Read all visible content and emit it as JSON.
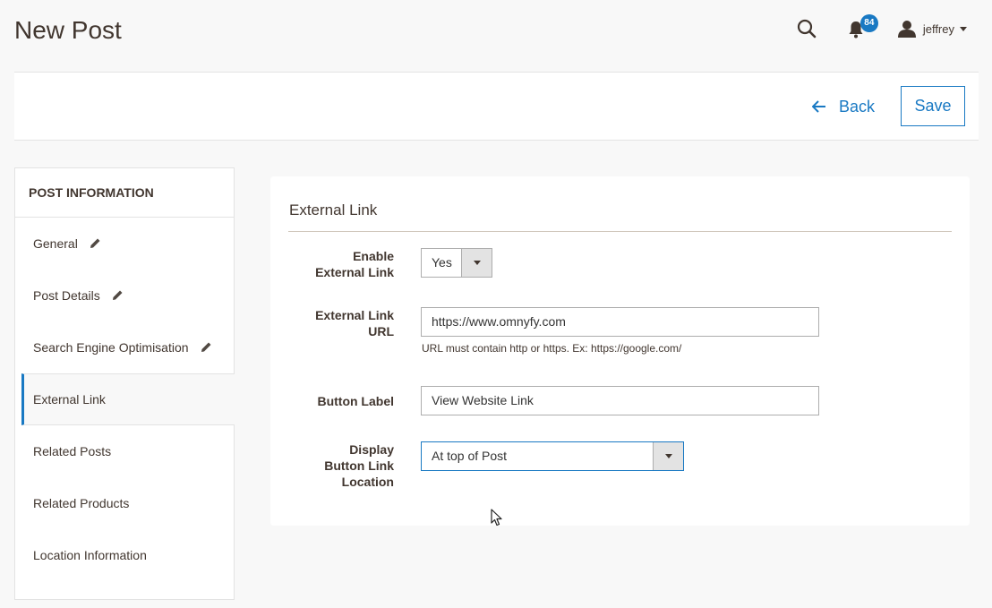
{
  "header": {
    "title": "New Post",
    "notifications_count": "84",
    "user_name": "jeffrey",
    "icons": {
      "search": "search-icon",
      "notifications": "bell-icon",
      "user": "user-icon",
      "dropdown": "caret-down-icon"
    }
  },
  "toolbar": {
    "back_label": "Back",
    "save_label": "Save"
  },
  "sidebar": {
    "title": "POST INFORMATION",
    "items": [
      {
        "label": "General",
        "edited": true
      },
      {
        "label": "Post Details",
        "edited": true
      },
      {
        "label": "Search Engine Optimisation",
        "edited": true
      },
      {
        "label": "External Link",
        "active": true
      },
      {
        "label": "Related Posts"
      },
      {
        "label": "Related Products"
      },
      {
        "label": "Location Information"
      }
    ]
  },
  "section": {
    "title": "External Link",
    "fields": {
      "enable": {
        "label_line1": "Enable",
        "label_line2": "External Link",
        "value": "Yes"
      },
      "url": {
        "label_line1": "External Link",
        "label_line2": "URL",
        "value": "https://www.omnyfy.com",
        "note": "URL must contain http or https. Ex: https://google.com/"
      },
      "button_label": {
        "label": "Button Label",
        "value": "View Website Link"
      },
      "location": {
        "label_line1": "Display",
        "label_line2": "Button Link",
        "label_line3": "Location",
        "value": "At top of Post"
      }
    }
  },
  "colors": {
    "accent": "#1979c3",
    "text": "#41362f",
    "background": "#f8f8f8"
  }
}
